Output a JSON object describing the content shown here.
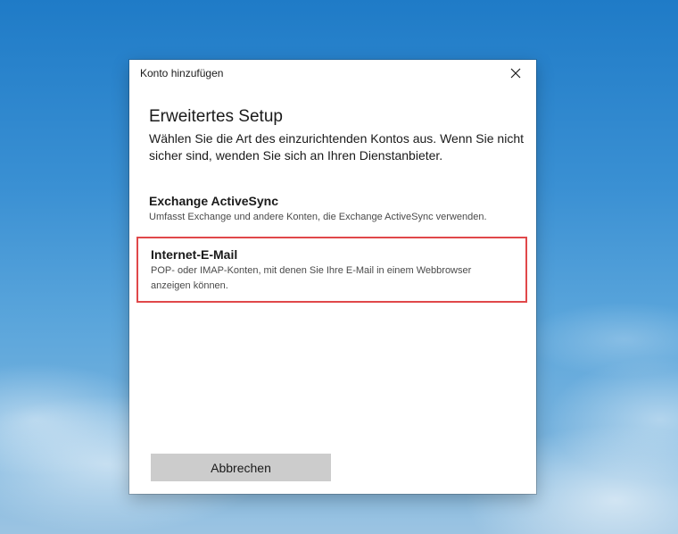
{
  "window": {
    "title": "Konto hinzufügen",
    "close_icon": "close-icon"
  },
  "main": {
    "heading": "Erweitertes Setup",
    "description": "Wählen Sie die Art des einzurichtenden Kontos aus. Wenn Sie nicht sicher sind, wenden Sie sich an Ihren Dienstanbieter.",
    "options": [
      {
        "title": "Exchange ActiveSync",
        "description": "Umfasst Exchange und andere Konten, die Exchange ActiveSync verwenden.",
        "highlighted": false
      },
      {
        "title": "Internet-E-Mail",
        "description": "POP- oder IMAP-Konten, mit denen Sie Ihre E-Mail in einem Webbrowser anzeigen können.",
        "highlighted": true
      }
    ]
  },
  "footer": {
    "cancel_label": "Abbrechen"
  },
  "colors": {
    "highlight_border": "#e0484a",
    "button_background": "#cccccc"
  }
}
